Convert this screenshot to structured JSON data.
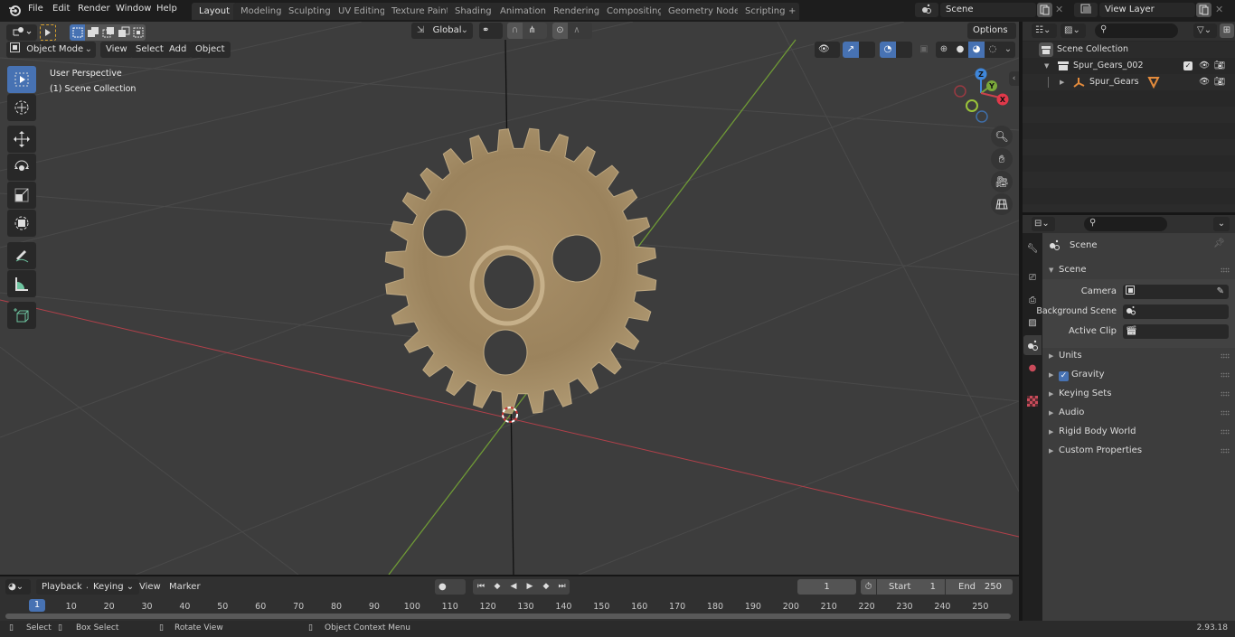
{
  "app": {
    "version": "2.93.18"
  },
  "topbar": {
    "menus": [
      "File",
      "Edit",
      "Render",
      "Window",
      "Help"
    ],
    "workspaces": [
      "Layout",
      "Modeling",
      "Sculpting",
      "UV Editing",
      "Texture Paint",
      "Shading",
      "Animation",
      "Rendering",
      "Compositing",
      "Geometry Nodes",
      "Scripting"
    ],
    "active_workspace": "Layout",
    "add_workspace": "+",
    "scene_name": "Scene",
    "view_layer_name": "View Layer"
  },
  "viewport": {
    "mode": "Object Mode",
    "menus": [
      "View",
      "Select",
      "Add",
      "Object"
    ],
    "transform_orientation": "Global",
    "options_label": "Options",
    "overlay_text": {
      "perspective": "User Perspective",
      "collection": "(1) Scene Collection"
    },
    "tools": [
      "select-box",
      "cursor",
      "move",
      "rotate",
      "scale",
      "transform",
      "annotate",
      "measure",
      "add-cube"
    ],
    "gizmo_axes": [
      "X",
      "Y",
      "Z"
    ],
    "nav_buttons": [
      "zoom",
      "pan",
      "camera",
      "ortho-grid"
    ],
    "object_name": "Spur_Gears",
    "colors": {
      "x_axis": "#c9424c",
      "y_axis": "#7aa83a",
      "z_axis": "#3f86d9",
      "gear": "#a88f68",
      "accent": "#4772b3"
    }
  },
  "outliner": {
    "search_placeholder": "",
    "root": "Scene Collection",
    "items": [
      {
        "name": "Spur_Gears_002",
        "type": "collection",
        "checked": true
      },
      {
        "name": "Spur_Gears",
        "type": "object"
      }
    ]
  },
  "properties": {
    "search_placeholder": "",
    "context": "Scene",
    "section_scene": "Scene",
    "fields": [
      {
        "label": "Camera",
        "value": ""
      },
      {
        "label": "Background Scene",
        "value": ""
      },
      {
        "label": "Active Clip",
        "value": ""
      }
    ],
    "panels": [
      "Units",
      "Gravity",
      "Keying Sets",
      "Audio",
      "Rigid Body World",
      "Custom Properties"
    ],
    "gravity_enabled": true
  },
  "timeline": {
    "menus": [
      "Playback",
      "Keying",
      "View",
      "Marker"
    ],
    "current_frame": "1",
    "start_label": "Start",
    "start": "1",
    "end_label": "End",
    "end": "250",
    "ticks": [
      "10",
      "20",
      "30",
      "40",
      "50",
      "60",
      "70",
      "80",
      "90",
      "100",
      "110",
      "120",
      "130",
      "140",
      "150",
      "160",
      "170",
      "180",
      "190",
      "200",
      "210",
      "220",
      "230",
      "240",
      "250"
    ],
    "playhead": "1"
  },
  "statusbar": {
    "items": [
      "Select",
      "Box Select",
      "Rotate View",
      "Object Context Menu"
    ]
  }
}
